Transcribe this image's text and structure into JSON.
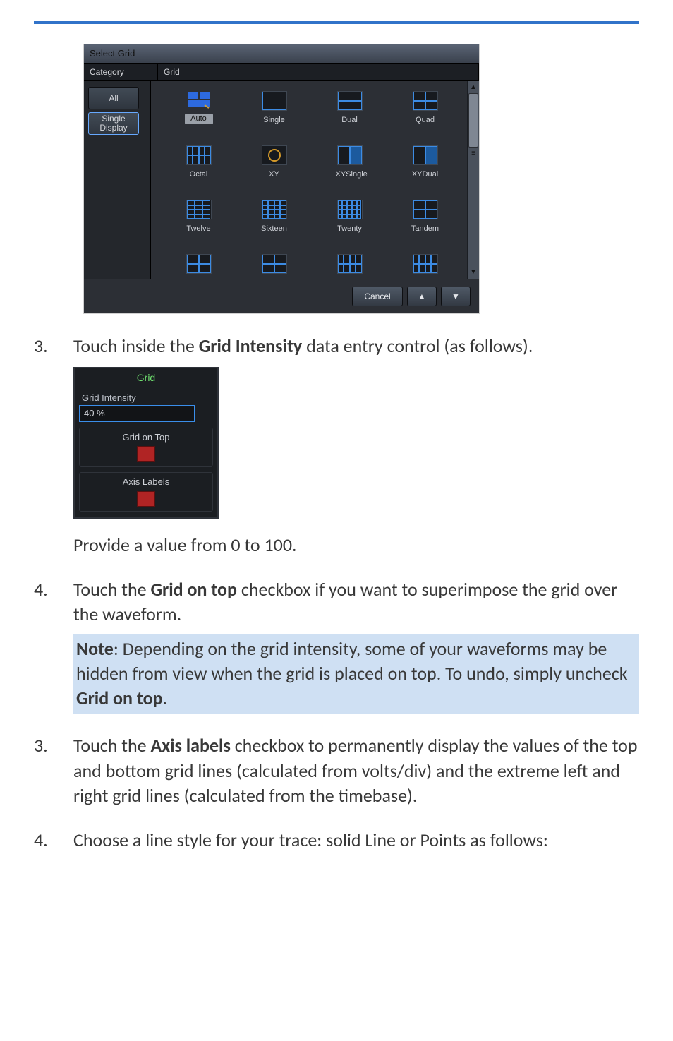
{
  "top_rule_color": "#3173c9",
  "dialog": {
    "title": "Select Grid",
    "headers": {
      "category": "Category",
      "grid": "Grid"
    },
    "categories": [
      {
        "label": "All",
        "selected": false
      },
      {
        "label_line1": "Single",
        "label_line2": "Display",
        "selected": true
      }
    ],
    "grid_items": [
      "Auto",
      "Single",
      "Dual",
      "Quad",
      "Octal",
      "XY",
      "XYSingle",
      "XYDual",
      "Twelve",
      "Sixteen",
      "Twenty",
      "Tandem",
      "",
      "",
      "",
      ""
    ],
    "scroll": {
      "up": "▲",
      "down": "▼",
      "drag": "≡"
    },
    "cancel": "Cancel",
    "nav_up": "▲",
    "nav_down": "▼"
  },
  "step3_pre": "Touch inside the ",
  "step3_bold": "Grid Intensity",
  "step3_post": " data entry control (as follows).",
  "mini": {
    "title": "Grid",
    "intensity_label": "Grid Intensity",
    "intensity_value": "40 %",
    "grid_on_top": "Grid on Top",
    "axis_labels": "Axis Labels"
  },
  "step3_tail": "Provide a value from 0 to 100.",
  "step4_pre": "Touch the ",
  "step4_bold": "Grid on top",
  "step4_post": " checkbox if you want to superimpose the grid over the waveform.",
  "note_bold": "Note",
  "note_text_1": ": Depending on the grid intensity, some of your waveforms may be hidden from view when the grid is placed on top. To undo, simply uncheck ",
  "note_bold2": "Grid on top",
  "note_text_2": ".",
  "step3b_pre": "Touch the ",
  "step3b_bold": "Axis labels",
  "step3b_post": " checkbox to permanently display the values of the top and bottom grid lines (calculated from volts/div) and the extreme left and right grid lines (calculated from the timebase).",
  "step4b": "Choose a line style for your trace: solid Line or Points as follows:",
  "numbers": {
    "n3": "3.",
    "n4": "4.",
    "n3b": "3.",
    "n4b": "4."
  }
}
